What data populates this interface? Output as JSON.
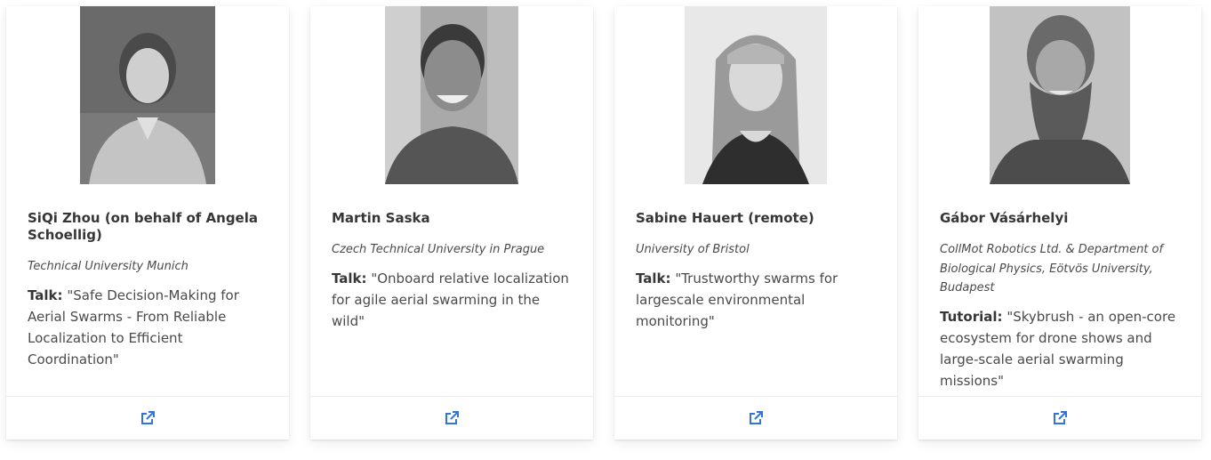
{
  "speakers": [
    {
      "name": "SiQi Zhou (on behalf of Angela Schoellig)",
      "affiliation": "Technical University Munich",
      "talk_type": "Talk:",
      "talk_title": "\"Safe Decision-Making for Aerial Swarms - From Reliable Localization to Efficient Coordination\"",
      "link_icon": "external-link-icon"
    },
    {
      "name": "Martin Saska",
      "affiliation": "Czech Technical University in Prague",
      "talk_type": "Talk:",
      "talk_title": "\"Onboard relative localization for agile aerial swarming in the wild\"",
      "link_icon": "external-link-icon"
    },
    {
      "name": "Sabine Hauert (remote)",
      "affiliation": "University of Bristol",
      "talk_type": "Talk:",
      "talk_title": "\"Trustworthy swarms for largescale environmental monitoring\"",
      "link_icon": "external-link-icon"
    },
    {
      "name": "Gábor Vásárhelyi",
      "affiliation": "CollMot Robotics Ltd. & Department of Biological Physics, Eötvös University, Budapest",
      "talk_type": "Tutorial:",
      "talk_title": "\"Skybrush - an open-core ecosystem for drone shows and large-scale aerial swarming missions\"",
      "link_icon": "external-link-icon"
    }
  ],
  "colors": {
    "link": "#3273dc",
    "text_strong": "#363636",
    "text": "#4a4a4a",
    "divider": "#ededed"
  }
}
